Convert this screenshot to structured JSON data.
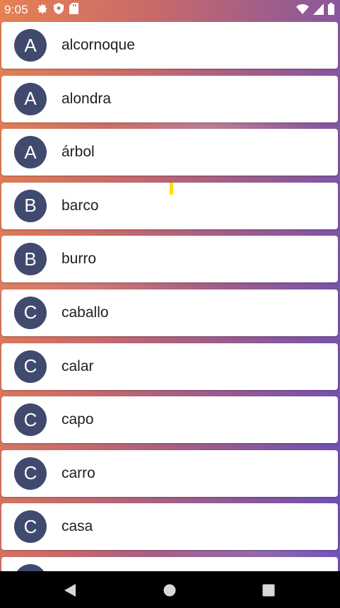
{
  "status_bar": {
    "time": "9:05",
    "left_icons": [
      "gear-icon",
      "shield-icon",
      "sd-card-icon"
    ],
    "right_icons": [
      "wifi-icon",
      "signal-icon",
      "battery-icon"
    ]
  },
  "items": [
    {
      "letter": "A",
      "word": "alcornoque"
    },
    {
      "letter": "A",
      "word": "alondra"
    },
    {
      "letter": "A",
      "word": "árbol"
    },
    {
      "letter": "B",
      "word": "barco"
    },
    {
      "letter": "B",
      "word": "burro"
    },
    {
      "letter": "C",
      "word": "caballo"
    },
    {
      "letter": "C",
      "word": "calar"
    },
    {
      "letter": "C",
      "word": "capo"
    },
    {
      "letter": "C",
      "word": "carro"
    },
    {
      "letter": "C",
      "word": "casa"
    }
  ],
  "nav_bar": {
    "buttons": [
      "back-icon",
      "home-icon",
      "recents-icon"
    ]
  },
  "colors": {
    "avatar": "#3f4a6e",
    "scroll_indicator": "#ffe000",
    "gradient_start": "#e58152",
    "gradient_end": "#6a4fb8"
  }
}
